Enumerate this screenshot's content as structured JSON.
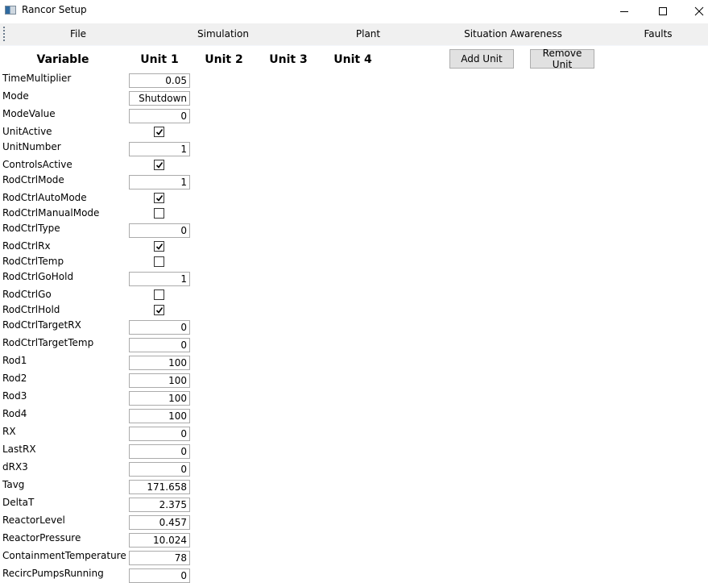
{
  "window": {
    "title": "Rancor Setup",
    "controls": [
      "minimize",
      "maximize",
      "close"
    ]
  },
  "menu": {
    "items": [
      "File",
      "Simulation",
      "Plant",
      "Situation Awareness",
      "Faults"
    ]
  },
  "grid": {
    "headers": {
      "variable": "Variable",
      "units": [
        "Unit 1",
        "Unit 2",
        "Unit 3",
        "Unit 4"
      ]
    },
    "add_unit_label": "Add Unit",
    "remove_unit_label": "Remove Unit",
    "rows": [
      {
        "name": "TimeMultiplier",
        "type": "text",
        "value": "0.05"
      },
      {
        "name": "Mode",
        "type": "text",
        "value": "Shutdown"
      },
      {
        "name": "ModeValue",
        "type": "text",
        "value": "0"
      },
      {
        "name": "UnitActive",
        "type": "checkbox",
        "checked": true
      },
      {
        "name": "UnitNumber",
        "type": "text",
        "value": "1"
      },
      {
        "name": "ControlsActive",
        "type": "checkbox",
        "checked": true
      },
      {
        "name": "RodCtrlMode",
        "type": "text",
        "value": "1"
      },
      {
        "name": "RodCtrlAutoMode",
        "type": "checkbox",
        "checked": true
      },
      {
        "name": "RodCtrlManualMode",
        "type": "checkbox",
        "checked": false
      },
      {
        "name": "RodCtrlType",
        "type": "text",
        "value": "0"
      },
      {
        "name": "RodCtrlRx",
        "type": "checkbox",
        "checked": true
      },
      {
        "name": "RodCtrlTemp",
        "type": "checkbox",
        "checked": false
      },
      {
        "name": "RodCtrlGoHold",
        "type": "text",
        "value": "1"
      },
      {
        "name": "RodCtrlGo",
        "type": "checkbox",
        "checked": false
      },
      {
        "name": "RodCtrlHold",
        "type": "checkbox",
        "checked": true
      },
      {
        "name": "RodCtrlTargetRX",
        "type": "text",
        "value": "0"
      },
      {
        "name": "RodCtrlTargetTemp",
        "type": "text",
        "value": "0"
      },
      {
        "name": "Rod1",
        "type": "text",
        "value": "100"
      },
      {
        "name": "Rod2",
        "type": "text",
        "value": "100"
      },
      {
        "name": "Rod3",
        "type": "text",
        "value": "100"
      },
      {
        "name": "Rod4",
        "type": "text",
        "value": "100"
      },
      {
        "name": "RX",
        "type": "text",
        "value": "0"
      },
      {
        "name": "LastRX",
        "type": "text",
        "value": "0"
      },
      {
        "name": "dRX3",
        "type": "text",
        "value": "0"
      },
      {
        "name": "Tavg",
        "type": "text",
        "value": "171.658"
      },
      {
        "name": "DeltaT",
        "type": "text",
        "value": "2.375"
      },
      {
        "name": "ReactorLevel",
        "type": "text",
        "value": "0.457"
      },
      {
        "name": "ReactorPressure",
        "type": "text",
        "value": "10.024"
      },
      {
        "name": "ContainmentTemperature",
        "type": "text",
        "value": "78"
      },
      {
        "name": "RecircPumpsRunning",
        "type": "text",
        "value": "0"
      }
    ]
  }
}
